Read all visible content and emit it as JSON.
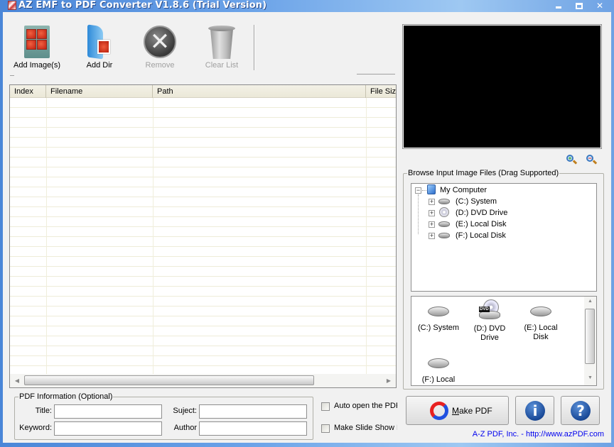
{
  "window": {
    "title": "AZ EMF to PDF Converter V1.8.6 (Trial Version)",
    "controls": {
      "minimize": "minimize",
      "maximize": "maximize",
      "close": "✕"
    }
  },
  "toolbar": {
    "add_images": "Add Image(s)",
    "add_dir": "Add Dir",
    "remove": "Remove",
    "clear_list": "Clear List"
  },
  "file_list": {
    "columns": [
      "Index",
      "Filename",
      "Path",
      "File Size"
    ],
    "rows": []
  },
  "preview": {
    "zoom_in": "zoom-in",
    "zoom_out": "zoom-out"
  },
  "browse": {
    "legend": "Browse Input Image Files (Drag Supported)",
    "tree": {
      "root": "My Computer",
      "children": [
        "(C:)  System",
        "(D:)  DVD Drive",
        "(E:)  Local Disk",
        "(F:)  Local Disk"
      ]
    },
    "icons": [
      {
        "line1": "(C:)  System",
        "line2": "",
        "type": "drive"
      },
      {
        "line1": "(D:)  DVD",
        "line2": "Drive",
        "type": "dvd"
      },
      {
        "line1": "(E:)  Local",
        "line2": "Disk",
        "type": "drive"
      },
      {
        "line1": "(F:)  Local",
        "line2": "",
        "type": "drive"
      }
    ]
  },
  "pdf_info": {
    "legend": "PDF Information (Optional)",
    "title_label": "Title:",
    "title_value": "",
    "subject_label": "Suject:",
    "subject_value": "",
    "keyword_label": "Keyword:",
    "keyword_value": "",
    "author_label": "Author",
    "author_value": ""
  },
  "options": {
    "auto_open": {
      "label": "Auto open the PDF",
      "checked": false
    },
    "slide_show": {
      "label": "Make Slide Show PDF",
      "checked": false
    }
  },
  "actions": {
    "make_pdf_mnemonic": "M",
    "make_pdf_rest": "ake PDF",
    "info": "i",
    "help": "?"
  },
  "footer": {
    "link": "A-Z PDF, Inc. - http://www.azPDF.com"
  }
}
